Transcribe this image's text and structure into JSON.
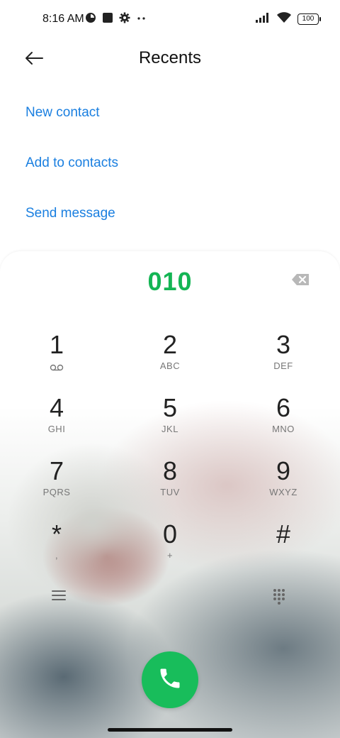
{
  "status_bar": {
    "time": "8:16 AM",
    "battery": "100",
    "icons": [
      "data-saver-icon",
      "square-notification-icon",
      "settings-gear-icon",
      "more-dots-icon",
      "signal-icon",
      "wifi-icon",
      "battery-icon"
    ]
  },
  "header": {
    "title": "Recents",
    "back_icon": "arrow-left-icon"
  },
  "actions": [
    {
      "label": "New contact"
    },
    {
      "label": "Add to contacts"
    },
    {
      "label": "Send message"
    }
  ],
  "dialer": {
    "number": "010",
    "number_color": "#14b554",
    "backspace_icon": "backspace-icon",
    "keys": [
      {
        "digit": "1",
        "letters": "",
        "icon": "voicemail-icon"
      },
      {
        "digit": "2",
        "letters": "ABC"
      },
      {
        "digit": "3",
        "letters": "DEF"
      },
      {
        "digit": "4",
        "letters": "GHI"
      },
      {
        "digit": "5",
        "letters": "JKL"
      },
      {
        "digit": "6",
        "letters": "MNO"
      },
      {
        "digit": "7",
        "letters": "PQRS"
      },
      {
        "digit": "8",
        "letters": "TUV"
      },
      {
        "digit": "9",
        "letters": "WXYZ"
      },
      {
        "digit": "*",
        "letters": ","
      },
      {
        "digit": "0",
        "letters": "+"
      },
      {
        "digit": "#",
        "letters": ""
      }
    ],
    "menu_icon": "menu-icon",
    "dialpad_icon": "dialpad-grid-icon",
    "call_icon": "phone-icon",
    "call_color": "#18bd5b"
  },
  "accent_color": "#1a7fe0"
}
